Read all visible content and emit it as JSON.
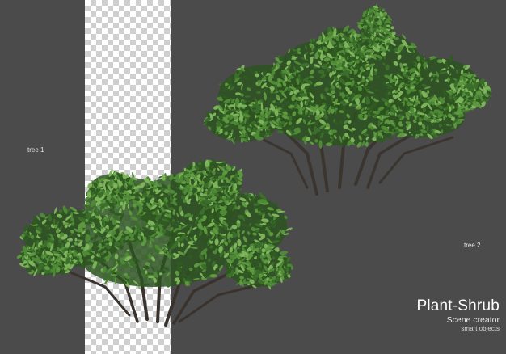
{
  "labels": {
    "tree1": "tree 1",
    "tree2": "tree 2"
  },
  "brand": {
    "title": "Plant-Shrub",
    "subtitle": "Scene creator",
    "tagline": "smart objects"
  },
  "colors": {
    "background": "#4b4b4b",
    "leaf_dark": "#2f5a22",
    "leaf_mid": "#4e8a36",
    "leaf_light": "#7db35a",
    "trunk": "#3b3530"
  }
}
